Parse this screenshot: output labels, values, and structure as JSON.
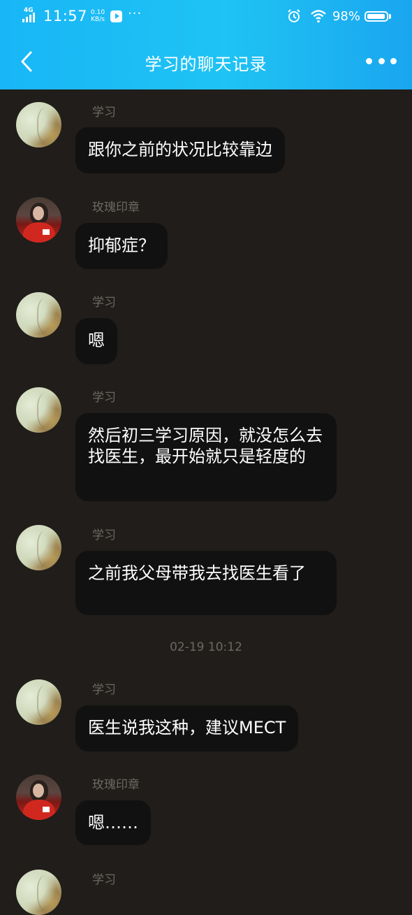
{
  "status_bar": {
    "network": "4G",
    "time": "11:57",
    "speed_value": "0.10",
    "speed_unit": "KB/s",
    "battery": "98%",
    "battery_level": 0.98
  },
  "nav": {
    "title": "学习的聊天记录",
    "back_icon": "chevron-left-icon",
    "more_icon": "more-dots-icon"
  },
  "messages": [
    {
      "sender": "学习",
      "text": "跟你之前的状况比较靠边"
    },
    {
      "sender": "玫瑰印章",
      "text": "抑郁症？"
    },
    {
      "sender": "学习",
      "text": "嗯"
    },
    {
      "sender": "学习",
      "text": "然后初三学习原因，就没怎么去找医生，最开始就只是轻度的"
    },
    {
      "sender": "学习",
      "text": "之前我父母带我去找医生看了"
    },
    {
      "sender": "学习",
      "text": "医生说我这种，建议MECT"
    },
    {
      "sender": "玫瑰印章",
      "text": "嗯……"
    },
    {
      "sender": "学习",
      "text": ""
    }
  ],
  "timestamp": "02-19 10:12"
}
